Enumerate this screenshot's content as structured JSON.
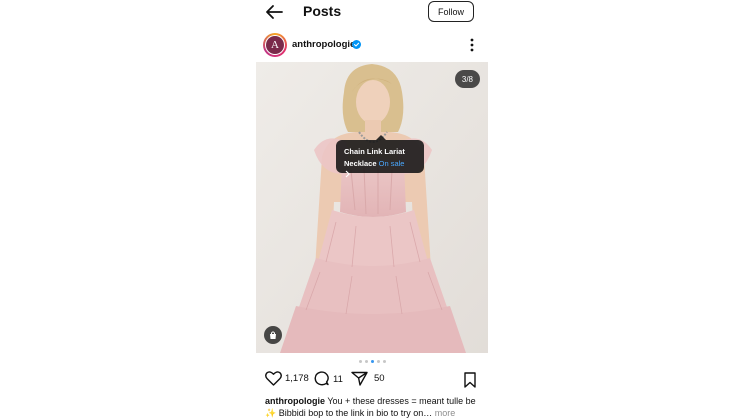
{
  "header": {
    "title": "Posts",
    "follow_label": "Follow"
  },
  "account": {
    "avatar_letter": "A",
    "username": "anthropologie"
  },
  "post": {
    "counter": "3/8",
    "tag": {
      "line1": "Chain Link Lariat",
      "line2": "Necklace",
      "sale": "On sale"
    },
    "carousel": {
      "total_dots": 5,
      "active_index": 2
    },
    "likes": "1,178",
    "comments": "11",
    "shares": "50",
    "caption": {
      "user": "anthropologie",
      "text": " You + these dresses = meant tulle be ✨ Bibbidi bop to the link in bio to try on… ",
      "more": "more"
    }
  },
  "colors": {
    "accent": "#3897f0",
    "verified": "#0095f6",
    "sale": "#4aa8ff",
    "dress": "#e9c3c3"
  }
}
